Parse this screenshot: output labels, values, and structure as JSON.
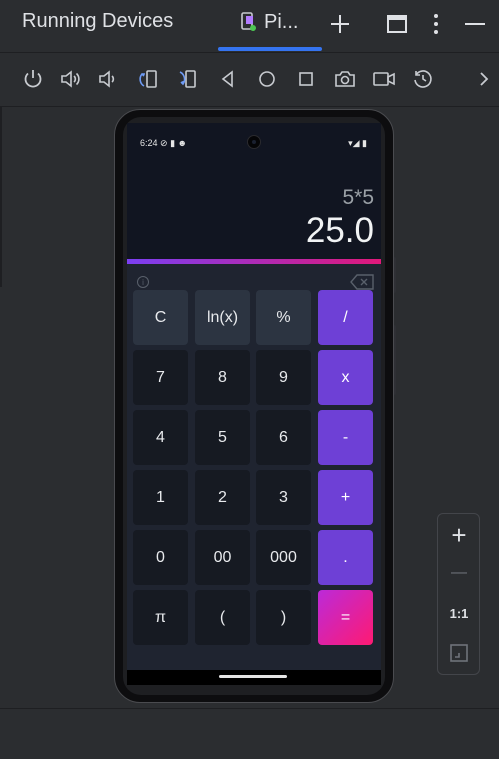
{
  "header": {
    "title": "Running Devices",
    "device_tab_label": "Pi...",
    "add_icon": "plus-icon",
    "layout_icon": "window-layout-icon",
    "more_icon": "more-vertical-icon",
    "minimize_icon": "minimize-icon"
  },
  "toolbar": {
    "icons": [
      "power-icon",
      "volume-up-icon",
      "volume-down-icon",
      "rotate-left-icon",
      "rotate-right-icon",
      "back-icon",
      "home-icon",
      "overview-icon",
      "screenshot-icon",
      "screen-record-icon",
      "reset-icon",
      "chevron-right-icon"
    ]
  },
  "device": {
    "status_time": "6:24",
    "status_icons": "⊘ ▮ ☻",
    "status_right": "▾◢ ▮"
  },
  "calculator": {
    "expression": "5*5",
    "result": "25.0",
    "info_label": "i",
    "keys": [
      {
        "label": "C",
        "kind": "fn"
      },
      {
        "label": "ln(x)",
        "kind": "fn"
      },
      {
        "label": "%",
        "kind": "fn"
      },
      {
        "label": "/",
        "kind": "op"
      },
      {
        "label": "7",
        "kind": "num"
      },
      {
        "label": "8",
        "kind": "num"
      },
      {
        "label": "9",
        "kind": "num"
      },
      {
        "label": "x",
        "kind": "op"
      },
      {
        "label": "4",
        "kind": "num"
      },
      {
        "label": "5",
        "kind": "num"
      },
      {
        "label": "6",
        "kind": "num"
      },
      {
        "label": "-",
        "kind": "op"
      },
      {
        "label": "1",
        "kind": "num"
      },
      {
        "label": "2",
        "kind": "num"
      },
      {
        "label": "3",
        "kind": "num"
      },
      {
        "label": "+",
        "kind": "op"
      },
      {
        "label": "0",
        "kind": "num"
      },
      {
        "label": "00",
        "kind": "num"
      },
      {
        "label": "000",
        "kind": "num"
      },
      {
        "label": ".",
        "kind": "op"
      },
      {
        "label": "π",
        "kind": "num"
      },
      {
        "label": "(",
        "kind": "num"
      },
      {
        "label": ")",
        "kind": "num"
      },
      {
        "label": "=",
        "kind": "eq"
      }
    ]
  },
  "zoom": {
    "zoom_in": "+",
    "zoom_out": "—",
    "actual_size": "1:1",
    "fit_icon": "fit-screen-icon"
  },
  "colors": {
    "accent": "#3574f0",
    "operator": "#6e40d6",
    "equals_start": "#bb2ad9",
    "equals_end": "#ff1a72"
  }
}
